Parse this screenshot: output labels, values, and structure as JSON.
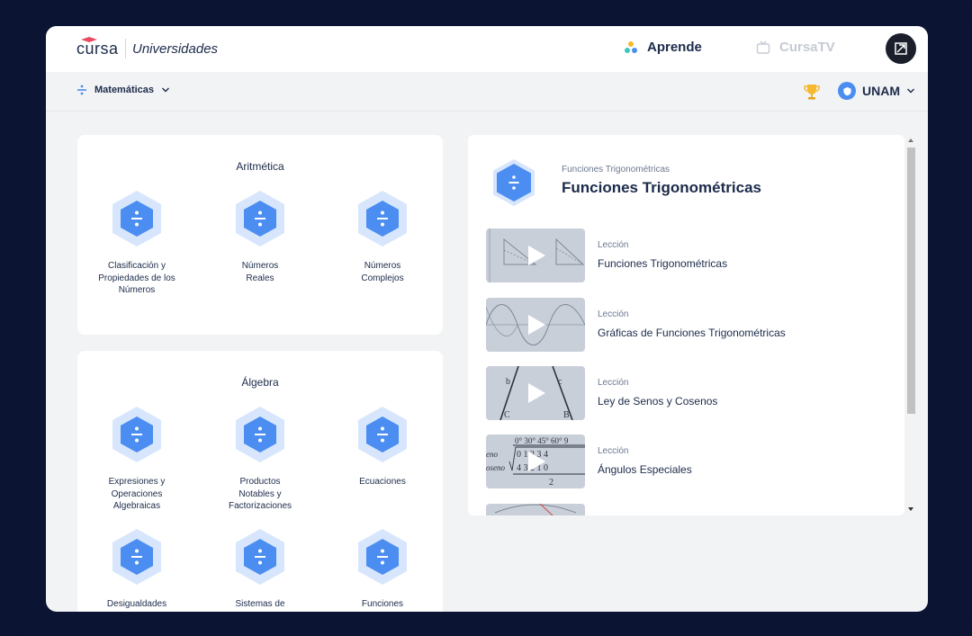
{
  "header": {
    "logo": "cursa",
    "logo_sub": "Universidades",
    "nav_aprende": "Aprende",
    "nav_tv": "CursaTV",
    "subject": "Matemáticas",
    "university": "UNAM"
  },
  "colors": {
    "accent": "#4b8df0",
    "hex_outer": "#d7e6fc",
    "navy": "#1c2b4a",
    "frame": "#0b1432"
  },
  "aritmetica": {
    "title": "Aritmética",
    "topics": [
      "Clasificación y Propiedades de los Números",
      "Números Reales",
      "Números Complejos"
    ]
  },
  "algebra": {
    "title": "Álgebra",
    "topics": [
      "Expresiones y Operaciones Algebraicas",
      "Productos Notables y Factorizaciones",
      "Ecuaciones",
      "Desigualdades",
      "Sistemas de",
      "Funciones"
    ]
  },
  "panel": {
    "kicker": "Funciones Trigonométricas",
    "title": "Funciones Trigonométricas",
    "lessons": [
      {
        "kind": "Lección",
        "name": "Funciones Trigonométricas"
      },
      {
        "kind": "Lección",
        "name": "Gráficas de Funciones Trigonométricas"
      },
      {
        "kind": "Lección",
        "name": "Ley de Senos y Cosenos"
      },
      {
        "kind": "Lección",
        "name": "Ángulos Especiales"
      }
    ],
    "thumb3_labels": {
      "b": "b",
      "c": "c",
      "C": "C",
      "B": "B"
    },
    "thumb4_labels": {
      "header": "0°  30°  45°  60°  9",
      "row1": "0  1  2  3  4",
      "row2": "4  3  2  1  0",
      "eno": "eno",
      "oseno": "oseno",
      "den": "2"
    }
  },
  "icons": [
    "divide-icon",
    "chevron-down-icon",
    "trophy-icon",
    "shield-icon",
    "play-icon",
    "tv-icon",
    "aprende-dots-icon",
    "user-avatar-icon"
  ]
}
